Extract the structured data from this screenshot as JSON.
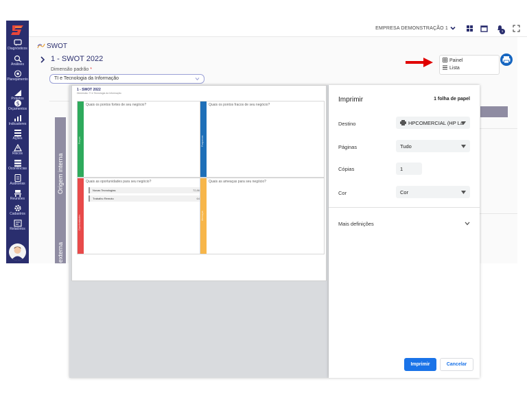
{
  "topbar": {
    "company": "EMPRESA DEMONSTRAÇÃO 1",
    "notification_count": "3"
  },
  "sidebar": {
    "items": [
      {
        "label": "Diagnósticos",
        "icon": "chat-icon"
      },
      {
        "label": "Análises",
        "icon": "analysis-icon"
      },
      {
        "label": "Planejamento",
        "icon": "target-icon"
      },
      {
        "label": "Projetos",
        "icon": "projects-icon"
      },
      {
        "label": "Orçamentos",
        "icon": "dollar-icon"
      },
      {
        "label": "Indicadores",
        "icon": "chart-icon"
      },
      {
        "label": "Ações",
        "icon": "list-icon"
      },
      {
        "label": "Riscos",
        "icon": "warning-icon"
      },
      {
        "label": "Ocorrências",
        "icon": "occurrence-icon"
      },
      {
        "label": "Auditorias",
        "icon": "audit-icon"
      },
      {
        "label": "Reuniões",
        "icon": "meeting-icon"
      },
      {
        "label": "Cadastros",
        "icon": "gear-icon"
      },
      {
        "label": "Relatórios",
        "icon": "report-icon"
      }
    ]
  },
  "main": {
    "page_title": "SWOT",
    "swot_heading": "1 - SWOT 2022",
    "dimension_label": "Dimensão padrão",
    "dimension_required": "*",
    "dimension_value": "TI e Tecnologia da Informação",
    "view_options": [
      "Painel",
      "Lista"
    ],
    "origem_interna": "Origem interna",
    "origem_externa": "externa"
  },
  "preview": {
    "title": "1 - SWOT 2022",
    "subtitle": "Dimensão: TI e Tecnologia da Informação",
    "quadrants": [
      {
        "question": "Quais os pontos fortes de seu negócio?",
        "label": "Forças",
        "color": "#2eaa5c"
      },
      {
        "question": "Quais os pontos fracos de seu negócio?",
        "label": "Fraquezas",
        "color": "#1e6fb8"
      },
      {
        "question": "Quais as oportunidades para seu negócio?",
        "label": "Oportunidades",
        "color": "#e84a4a"
      },
      {
        "question": "Quais as ameaças para seu negócio?",
        "label": "Ameaças",
        "color": "#f7b64a"
      }
    ],
    "opportunity_items": [
      {
        "name": "Novas Tecnologias",
        "score": "72,86"
      },
      {
        "name": "Trabalho Remoto",
        "score": "64"
      }
    ]
  },
  "print": {
    "title": "Imprimir",
    "pages_summary": "1 folha de papel",
    "destination_label": "Destino",
    "destination_value": "HPCOMERCIAL (HP La",
    "pages_label": "Páginas",
    "pages_value": "Tudo",
    "copies_label": "Cópias",
    "copies_value": "1",
    "color_label": "Cor",
    "color_value": "Cor",
    "more_settings": "Mais definições",
    "print_button": "Imprimir",
    "cancel_button": "Cancelar"
  },
  "colors": {
    "sidebar": "#2a2e6e",
    "accent": "#1a73e8",
    "arrow": "#e00000"
  }
}
